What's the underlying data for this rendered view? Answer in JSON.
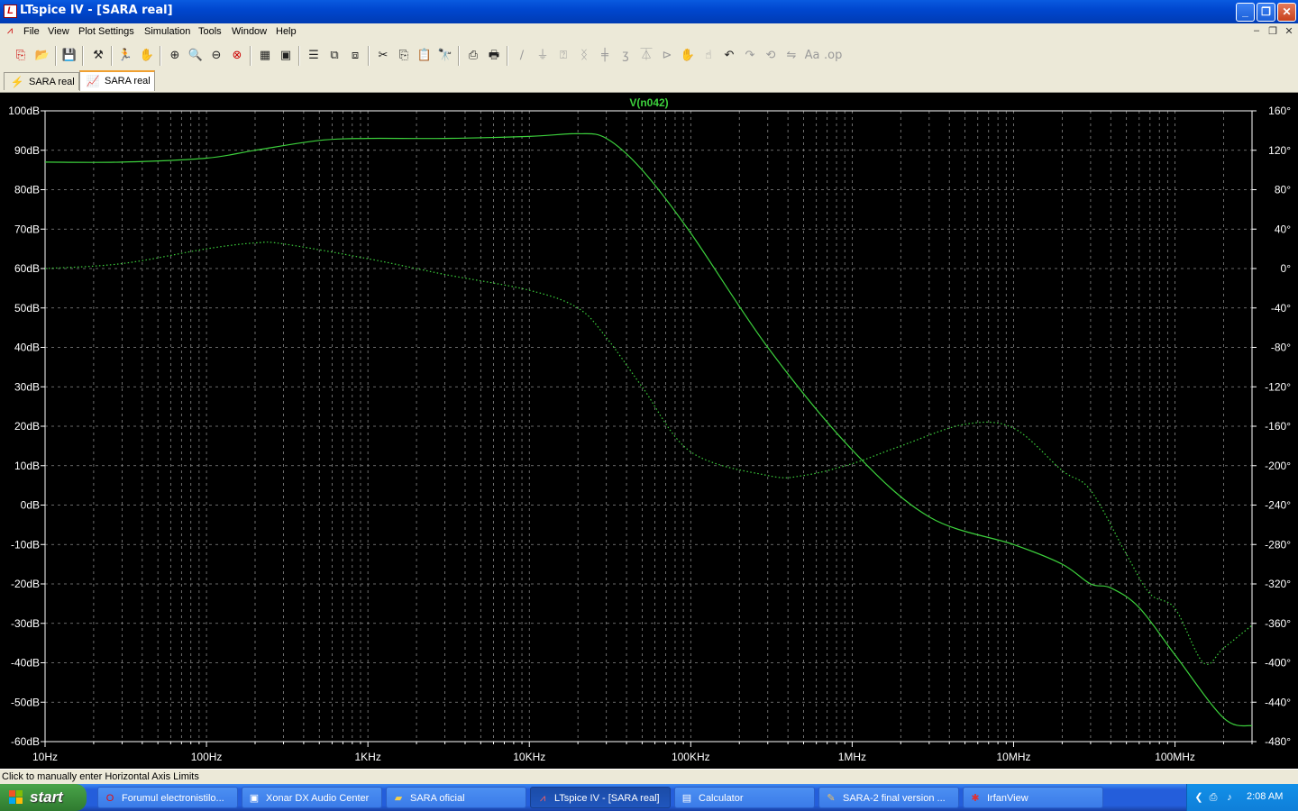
{
  "window": {
    "title": "LTspice IV - [SARA real]"
  },
  "menu": [
    "File",
    "View",
    "Plot Settings",
    "Simulation",
    "Tools",
    "Window",
    "Help"
  ],
  "tabs": [
    {
      "label": "SARA real",
      "icon": "schematic-icon",
      "active": false
    },
    {
      "label": "SARA real",
      "icon": "waveform-icon",
      "active": true
    }
  ],
  "status": {
    "text": "Click to manually enter Horizontal Axis Limits"
  },
  "taskbar": {
    "start_label": "start",
    "tasks": [
      {
        "label": "Forumul electronistilo...",
        "icon": "opera-icon"
      },
      {
        "label": "Xonar DX Audio Center",
        "icon": "audio-center-icon"
      },
      {
        "label": "SARA oficial",
        "icon": "folder-icon"
      },
      {
        "label": "LTspice IV - [SARA real]",
        "icon": "ltspice-icon",
        "active": true
      },
      {
        "label": "Calculator",
        "icon": "calculator-icon"
      },
      {
        "label": "SARA-2 final version ...",
        "icon": "document-icon"
      },
      {
        "label": "IrfanView",
        "icon": "irfanview-icon"
      }
    ],
    "clock": "2:08 AM"
  },
  "chart_data": {
    "type": "line",
    "title": "V(n042)",
    "x_scale": "log",
    "xlim": [
      10,
      300000000
    ],
    "x_ticks": [
      10,
      100,
      1000,
      10000,
      100000,
      1000000,
      10000000,
      100000000
    ],
    "x_tick_labels": [
      "10Hz",
      "100Hz",
      "1KHz",
      "10KHz",
      "100KHz",
      "1MHz",
      "10MHz",
      "100MHz"
    ],
    "y_left": {
      "unit": "dB",
      "lim": [
        -60,
        100
      ],
      "ticks": [
        100,
        90,
        80,
        70,
        60,
        50,
        40,
        30,
        20,
        10,
        0,
        -10,
        -20,
        -30,
        -40,
        -50,
        -60
      ],
      "tick_labels": [
        "100dB",
        "90dB",
        "80dB",
        "70dB",
        "60dB",
        "50dB",
        "40dB",
        "30dB",
        "20dB",
        "10dB",
        "0dB",
        "-10dB",
        "-20dB",
        "-30dB",
        "-40dB",
        "-50dB",
        "-60dB"
      ]
    },
    "y_right": {
      "unit": "deg",
      "lim": [
        -480,
        160
      ],
      "ticks": [
        160,
        120,
        80,
        40,
        0,
        -40,
        -80,
        -120,
        -160,
        -200,
        -240,
        -280,
        -320,
        -360,
        -400,
        -440,
        -480
      ],
      "tick_labels": [
        "160°",
        "120°",
        "80°",
        "40°",
        "0°",
        "-40°",
        "-80°",
        "-120°",
        "-160°",
        "-200°",
        "-240°",
        "-280°",
        "-320°",
        "-360°",
        "-400°",
        "-440°",
        "-480°"
      ]
    },
    "grid": true,
    "series": [
      {
        "axis": "left",
        "style": "solid",
        "x": [
          10,
          30,
          100,
          200,
          500,
          1000,
          3000,
          10000,
          20000,
          30000,
          50000,
          100000,
          300000,
          1000000,
          3000000,
          10000000,
          20000000,
          30000000,
          40000000,
          60000000,
          100000000,
          200000000,
          300000000
        ],
        "y": [
          87,
          87,
          88,
          90,
          92.5,
          93,
          93,
          93.5,
          94.2,
          93,
          85,
          69,
          40,
          14,
          -3,
          -10,
          -15,
          -20,
          -21,
          -26,
          -38,
          -54,
          -56
        ]
      },
      {
        "axis": "right",
        "style": "dotted",
        "x": [
          10,
          30,
          100,
          200,
          300,
          1000,
          3000,
          10000,
          20000,
          30000,
          50000,
          100000,
          300000,
          500000,
          1000000,
          2000000,
          5000000,
          10000000,
          20000000,
          30000000,
          50000000,
          70000000,
          100000000,
          150000000,
          200000000,
          300000000
        ],
        "y": [
          0,
          5,
          20,
          26,
          25,
          10,
          -6,
          -22,
          -40,
          -70,
          -120,
          -186,
          -210,
          -210,
          -198,
          -180,
          -158,
          -162,
          -205,
          -225,
          -290,
          -330,
          -345,
          -400,
          -385,
          -362
        ]
      }
    ]
  }
}
